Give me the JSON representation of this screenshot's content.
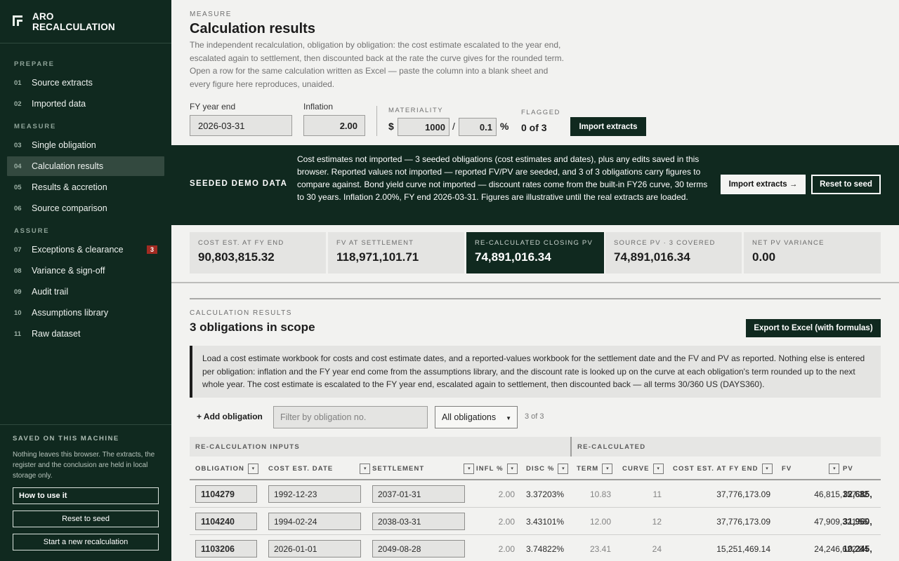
{
  "app": {
    "brand_line1": "ARO",
    "brand_line2": "RECALCULATION"
  },
  "sidebar": {
    "sections": [
      {
        "title": "PREPARE"
      },
      {
        "title": "MEASURE"
      },
      {
        "title": "ASSURE"
      }
    ],
    "items": [
      {
        "num": "01",
        "label": "Source extracts"
      },
      {
        "num": "02",
        "label": "Imported data"
      },
      {
        "num": "03",
        "label": "Single obligation"
      },
      {
        "num": "04",
        "label": "Calculation results",
        "active": true
      },
      {
        "num": "05",
        "label": "Results & accretion"
      },
      {
        "num": "06",
        "label": "Source comparison"
      },
      {
        "num": "07",
        "label": "Exceptions & clearance",
        "badge": "3"
      },
      {
        "num": "08",
        "label": "Variance & sign-off"
      },
      {
        "num": "09",
        "label": "Audit trail"
      },
      {
        "num": "10",
        "label": "Assumptions library"
      },
      {
        "num": "11",
        "label": "Raw dataset"
      }
    ],
    "saved": {
      "title": "SAVED ON THIS MACHINE",
      "text": "Nothing leaves this browser. The extracts, the register and the conclusion are held in local storage only.",
      "how_to": "How to use it",
      "reset": "Reset to seed",
      "new": "Start a new recalculation"
    }
  },
  "header": {
    "eyebrow": "MEASURE",
    "title": "Calculation results",
    "intro": "The independent recalculation, obligation by obligation: the cost estimate escalated to the year end, escalated again to settlement, then discounted back at the rate the curve gives for the rounded term. Open a row for the same calculation written as Excel — paste the column into a blank sheet and every figure here reproduces, unaided."
  },
  "controls": {
    "fy_label": "FY year end",
    "fy_value": "2026-03-31",
    "inflation_label": "Inflation",
    "inflation_value": "2.00",
    "materiality_label": "MATERIALITY",
    "currency": "$",
    "materiality_amount": "1000",
    "slash": "/",
    "materiality_pct": "0.1",
    "pct_sign": "%",
    "flagged_label": "FLAGGED",
    "flagged_value": "0 of 3",
    "import_button": "Import extracts"
  },
  "banner": {
    "title": "SEEDED DEMO DATA",
    "text": "Cost estimates not imported — 3 seeded obligations (cost estimates and dates), plus any edits saved in this browser. Reported values not imported — reported FV/PV are seeded, and 3 of 3 obligations carry figures to compare against. Bond yield curve not imported — discount rates come from the built-in FY26 curve, 30 terms to 30 years. Inflation 2.00%, FY end 2026-03-31. Figures are illustrative until the real extracts are loaded.",
    "import_button": "Import extracts →",
    "reset_button": "Reset to seed"
  },
  "stats": [
    {
      "label": "COST EST. AT FY END",
      "value": "90,803,815.32"
    },
    {
      "label": "FV AT SETTLEMENT",
      "value": "118,971,101.71"
    },
    {
      "label": "RE-CALCULATED CLOSING PV",
      "value": "74,891,016.34",
      "highlight": true
    },
    {
      "label": "SOURCE PV · 3 COVERED",
      "value": "74,891,016.34"
    },
    {
      "label": "NET PV VARIANCE",
      "value": "0.00"
    }
  ],
  "results": {
    "eyebrow": "CALCULATION RESULTS",
    "title": "3 obligations in scope",
    "export_button": "Export to Excel (with formulas)",
    "note": "Load a cost estimate workbook for costs and cost estimate dates, and a reported-values workbook for the settlement date and the FV and PV as reported. Nothing else is entered per obligation: inflation and the FY year end come from the assumptions library, and the discount rate is looked up on the curve at each obligation's term rounded up to the next whole year. The cost estimate is escalated to the FY year end, escalated again to settlement, then discounted back — all terms 30/360 US (DAYS360).",
    "add_button": "+ Add obligation",
    "filter_placeholder": "Filter by obligation no.",
    "filter_select": "All obligations",
    "count": "3 of 3"
  },
  "table": {
    "group_inputs": "RE-CALCULATION INPUTS",
    "group_recalc": "RE-CALCULATED",
    "columns": [
      "OBLIGATION",
      "COST EST. DATE",
      "SETTLEMENT",
      "INFL %",
      "DISC %",
      "TERM",
      "CURVE",
      "COST EST. AT FY END",
      "FV",
      "PV"
    ],
    "sort_glyph": "▾",
    "rows": [
      {
        "obligation": "1104279",
        "cost_date": "1992-12-23",
        "settlement": "2037-01-31",
        "infl": "2.00",
        "disc": "3.37203%",
        "term": "10.83",
        "curve": "11",
        "cost_fy": "37,776,173.09",
        "fv": "46,815,157.32",
        "pv": "32,685,"
      },
      {
        "obligation": "1104240",
        "cost_date": "1994-02-24",
        "settlement": "2038-03-31",
        "infl": "2.00",
        "disc": "3.43101%",
        "term": "12.00",
        "curve": "12",
        "cost_fy": "37,776,173.09",
        "fv": "47,909,321.55",
        "pv": "31,960,"
      },
      {
        "obligation": "1103206",
        "cost_date": "2026-01-01",
        "settlement": "2049-08-28",
        "infl": "2.00",
        "disc": "3.74822%",
        "term": "23.41",
        "curve": "24",
        "cost_fy": "15,251,469.14",
        "fv": "24,246,622.84",
        "pv": "10,245,"
      }
    ]
  }
}
